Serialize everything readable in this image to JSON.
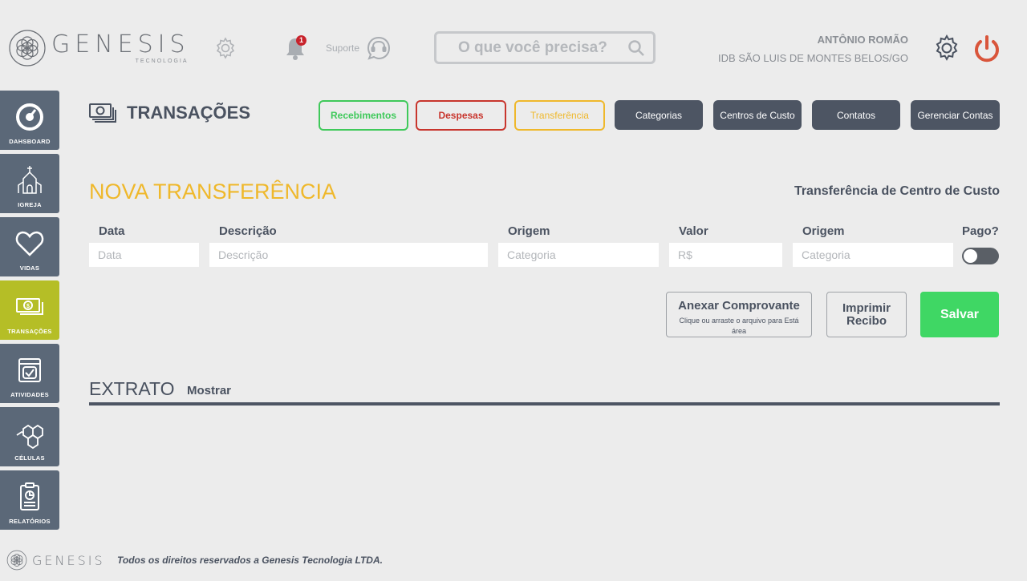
{
  "brand": {
    "name": "GENESIS",
    "sub": "TECNOLOGIA"
  },
  "header": {
    "notifications_count": "1",
    "support_label": "Suporte",
    "search_placeholder": "O que você precisa?",
    "user_name": "ANTÔNIO ROMÃO",
    "user_org": "IDB SÃO LUIS DE MONTES BELOS/GO"
  },
  "sidebar": {
    "items": [
      {
        "label": "DAHSBOARD",
        "icon": "dashboard-icon"
      },
      {
        "label": "IGREJA",
        "icon": "church-icon"
      },
      {
        "label": "VIDAS",
        "icon": "heart-icon"
      },
      {
        "label": "TRANSAÇÕES",
        "icon": "money-icon",
        "active": true
      },
      {
        "label": "ATIVIDADES",
        "icon": "calendar-check-icon"
      },
      {
        "label": "CÉLULAS",
        "icon": "hexagons-icon"
      },
      {
        "label": "RELATÓRIOS",
        "icon": "report-icon"
      }
    ]
  },
  "page": {
    "title": "TRANSAÇÕES",
    "tabs": {
      "recebimentos": "Recebimentos",
      "despesas": "Despesas",
      "transferencia": "Transferência",
      "categorias": "Categorias",
      "centros": "Centros de Custo",
      "contatos": "Contatos",
      "contas": "Gerenciar Contas"
    },
    "colors": {
      "green": "#3fc95a",
      "red": "#c8352d",
      "yellow": "#efb82b",
      "dark": "#4d5563",
      "active_sidebar": "#b5be26"
    }
  },
  "form": {
    "title": "NOVA TRANSFERÊNCIA",
    "alt_link": "Transferência de Centro de Custo",
    "labels": {
      "data": "Data",
      "descricao": "Descrição",
      "origem1": "Origem",
      "valor": "Valor",
      "origem2": "Origem",
      "pago": "Pago?"
    },
    "placeholders": {
      "data": "Data",
      "descricao": "Descrição",
      "origem1": "Categoria",
      "valor": "R$",
      "origem2": "Categoria"
    },
    "paid": false,
    "attach": {
      "title": "Anexar Comprovante",
      "sub": "Clique ou arraste o arquivo para Está área"
    },
    "print": "Imprimir Recibo",
    "save": "Salvar"
  },
  "extrato": {
    "title": "EXTRATO",
    "link": "Mostrar"
  },
  "footer": {
    "brand": "GENESIS",
    "text": "Todos os direitos reservados a Genesis Tecnologia LTDA."
  }
}
